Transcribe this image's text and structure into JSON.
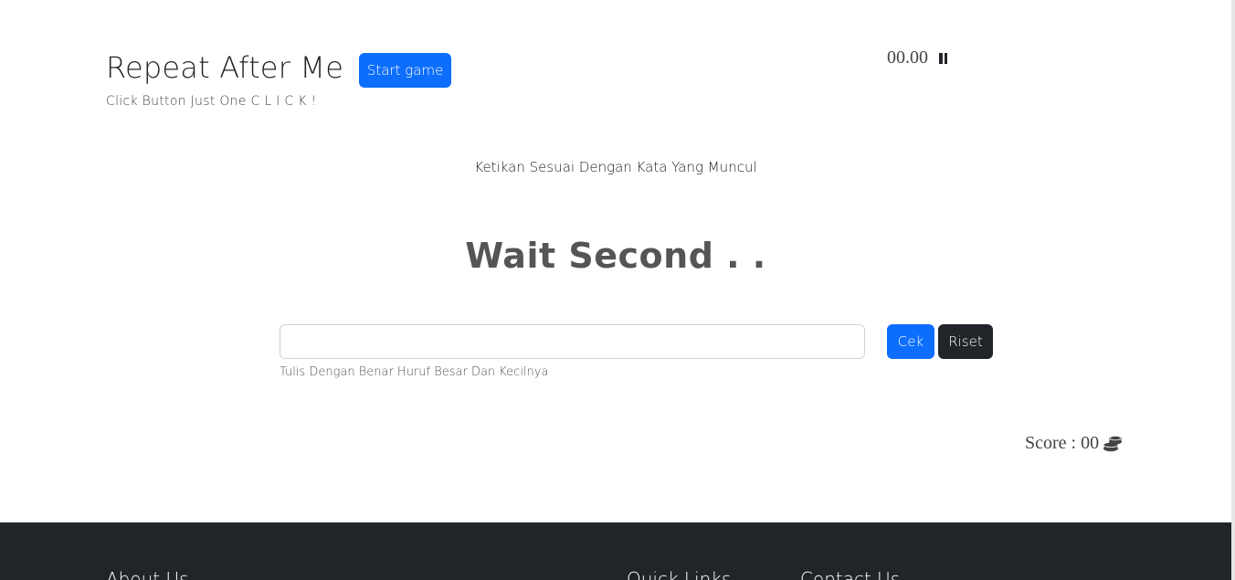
{
  "header": {
    "title": "Repeat After Me",
    "start_label": "Start game",
    "subtitle": "Click Button Just One C L I C K !"
  },
  "timer": {
    "value": "00.00",
    "icon": "pause-icon"
  },
  "game": {
    "instruction": "Ketikan Sesuai Dengan Kata Yang Muncul",
    "word": "Wait Second . .",
    "input_value": "",
    "input_placeholder": "",
    "help_text": "Tulis Dengan Benar Huruf Besar Dan Kecilnya",
    "check_label": "Cek",
    "reset_label": "Riset"
  },
  "score": {
    "label": "Score : 00",
    "icon": "coins-icon"
  },
  "footer": {
    "about_title": "About Us",
    "links_title": "Quick Links",
    "contact_title": "Contact Us"
  },
  "colors": {
    "primary": "#0d6efd",
    "dark": "#212529",
    "footer_bg": "#212529",
    "word_color": "#555555"
  }
}
